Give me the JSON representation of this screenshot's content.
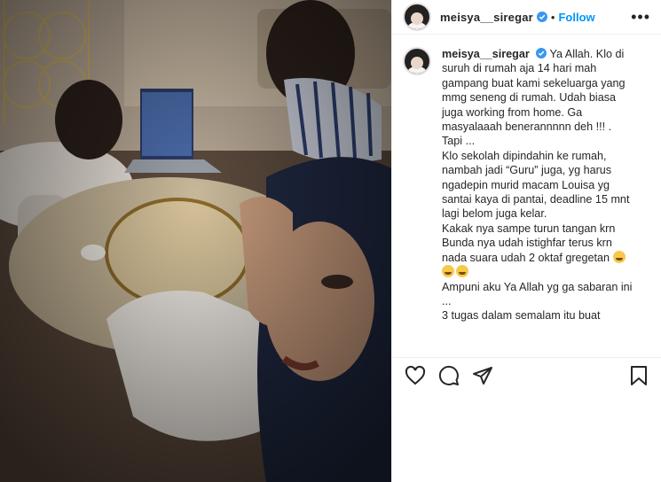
{
  "post": {
    "username": "meisya__siregar",
    "follow_label": "Follow",
    "separator": "•",
    "more_label": "•••"
  },
  "caption": {
    "username": "meisya__siregar",
    "lines": [
      "Ya Allah. Klo di",
      "suruh di rumah aja 14 hari mah",
      "gampang buat kami sekeluarga yang",
      "mmg seneng di rumah. Udah biasa",
      "juga working from home. Ga",
      "masyalaaah benerannnnn deh !!! .",
      "Tapi ...",
      "Klo sekolah dipindahin ke rumah,",
      "nambah jadi “Guru” juga, yg harus",
      "ngadepin murid macam Louisa yg",
      "santai kaya di pantai, deadline 15 mnt",
      "lagi belom juga kelar.",
      "Kakak nya sampe turun tangan krn",
      "Bunda nya udah istighfar terus krn",
      "nada suara udah 2 oktaf gregetan",
      "",
      "Ampuni aku Ya Allah yg ga sabaran ini",
      "...",
      "3 tugas dalam semalam itu buat"
    ]
  },
  "icons": {
    "like": "heart-icon",
    "comment": "comment-icon",
    "share": "share-icon",
    "save": "bookmark-icon",
    "more": "more-options-icon",
    "verified": "verified-badge-icon",
    "emoji": "crying-face-emoji"
  },
  "colors": {
    "accent": "#0095f6",
    "text": "#262626",
    "divider": "#efefef"
  }
}
